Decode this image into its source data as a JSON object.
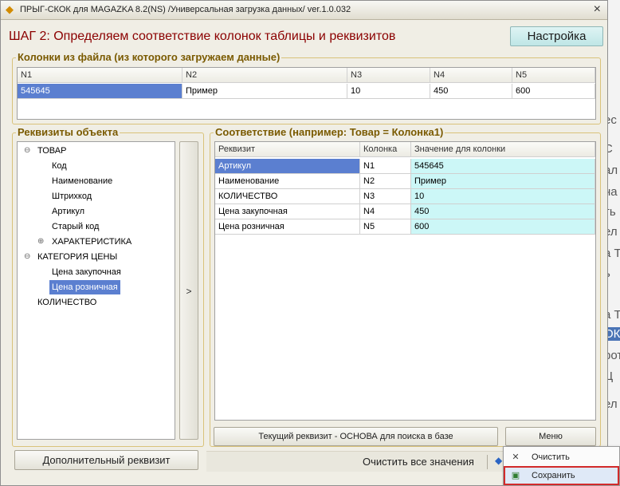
{
  "window": {
    "title": "ПРЫГ-СКОК для MAGAZKA 8.2(NS)  /Универсальная загрузка данных/ ver.1.0.032",
    "close": "×"
  },
  "step_title": "ШАГ 2: Определяем соответствие колонок таблицы и реквизитов",
  "settings_label": "Настройка",
  "file_columns": {
    "group_title": "Колонки из файла (из которого загружаем данные)",
    "headers": [
      "N1",
      "N2",
      "N3",
      "N4",
      "N5"
    ],
    "row": [
      "545645",
      "Пример",
      "10",
      "450",
      "600"
    ]
  },
  "object_attrs": {
    "group_title": "Реквизиты объекта",
    "tree": [
      {
        "label": "ТОВАР",
        "toggle": "⊖"
      },
      {
        "label": "Код"
      },
      {
        "label": "Наименование"
      },
      {
        "label": "Штрихкод"
      },
      {
        "label": "Артикул"
      },
      {
        "label": "Старый код"
      },
      {
        "label": "ХАРАКТЕРИСТИКА",
        "toggle": "⊕"
      },
      {
        "label": "КАТЕГОРИЯ ЦЕНЫ",
        "toggle": "⊖"
      },
      {
        "label": "Цена закупочная"
      },
      {
        "label": "Цена розничная"
      },
      {
        "label": "КОЛИЧЕСТВО"
      }
    ],
    "arrow": ">",
    "add_button": "Дополнительный реквизит"
  },
  "matching": {
    "group_title": "Соответствие (например: Товар = Колонка1)",
    "headers": [
      "Реквизит",
      "Колонка",
      "Значение для колонки"
    ],
    "rows": [
      [
        "Артикул",
        "N1",
        "545645"
      ],
      [
        "Наименование",
        "N2",
        "Пример"
      ],
      [
        "КОЛИЧЕСТВО",
        "N3",
        "10"
      ],
      [
        "Цена закупочная",
        "N4",
        "450"
      ],
      [
        "Цена розничная",
        "N5",
        "600"
      ]
    ],
    "base_button": "Текущий реквизит - ОСНОВА для поиска в базе",
    "menu_button": "Меню"
  },
  "bottom": {
    "clear_all": "Очистить все значения"
  },
  "context_menu": {
    "clear": "Очистить",
    "save": "Сохранить"
  },
  "background_window": {
    "lines": [
      "ес",
      "С",
      "ал",
      "на",
      "ть",
      "ел",
      "а Т",
      "ь",
      "а Т",
      "ОК",
      "рот",
      "Ц",
      "ел"
    ]
  },
  "colors": {
    "step_title": "#8b0000",
    "selection": "#5b7fd0",
    "cyan_cell": "#ccf7f7",
    "highlight_border": "#d22a2a"
  }
}
